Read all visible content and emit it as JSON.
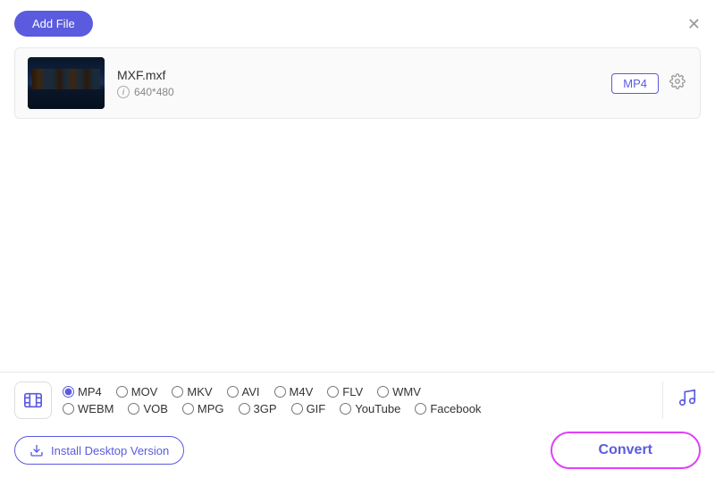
{
  "topBar": {
    "addFileLabel": "Add File",
    "closeTitle": "Close"
  },
  "fileItem": {
    "name": "MXF.mxf",
    "resolution": "640*480",
    "format": "MP4",
    "infoTooltip": "i"
  },
  "formatBar": {
    "videoFormats": [
      {
        "id": "mp4",
        "label": "MP4",
        "checked": true
      },
      {
        "id": "mov",
        "label": "MOV",
        "checked": false
      },
      {
        "id": "mkv",
        "label": "MKV",
        "checked": false
      },
      {
        "id": "avi",
        "label": "AVI",
        "checked": false
      },
      {
        "id": "m4v",
        "label": "M4V",
        "checked": false
      },
      {
        "id": "flv",
        "label": "FLV",
        "checked": false
      },
      {
        "id": "wmv",
        "label": "WMV",
        "checked": false
      }
    ],
    "videoFormats2": [
      {
        "id": "webm",
        "label": "WEBM",
        "checked": false
      },
      {
        "id": "vob",
        "label": "VOB",
        "checked": false
      },
      {
        "id": "mpg",
        "label": "MPG",
        "checked": false
      },
      {
        "id": "3gp",
        "label": "3GP",
        "checked": false
      },
      {
        "id": "gif",
        "label": "GIF",
        "checked": false
      },
      {
        "id": "youtube",
        "label": "YouTube",
        "checked": false
      },
      {
        "id": "facebook",
        "label": "Facebook",
        "checked": false
      }
    ]
  },
  "bottomBar": {
    "installLabel": "Install Desktop Version",
    "convertLabel": "Convert"
  }
}
